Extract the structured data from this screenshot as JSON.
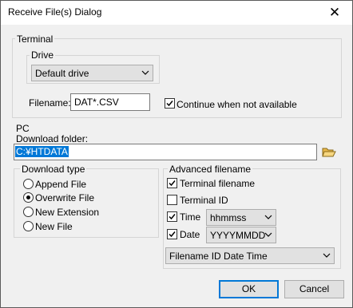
{
  "window": {
    "title": "Receive File(s) Dialog",
    "close_glyph": "✕"
  },
  "terminal": {
    "group_label": "Terminal",
    "drive": {
      "group_label": "Drive",
      "selected": "Default drive"
    },
    "filename": {
      "label": "Filename:",
      "value": "DAT*.CSV"
    },
    "continue": {
      "label": "Continue when not available",
      "checked": true
    }
  },
  "pc": {
    "group_label": "PC",
    "download_folder": {
      "label": "Download folder:",
      "value": "C:¥HTDATA"
    }
  },
  "download_type": {
    "group_label": "Download type",
    "options": [
      {
        "label": "Append File",
        "selected": false
      },
      {
        "label": "Overwrite File",
        "selected": true
      },
      {
        "label": "New Extension",
        "selected": false
      },
      {
        "label": "New File",
        "selected": false
      }
    ]
  },
  "advanced": {
    "group_label": "Advanced filename",
    "terminal_filename": {
      "label": "Terminal filename",
      "checked": true
    },
    "terminal_id": {
      "label": "Terminal ID",
      "checked": false
    },
    "time": {
      "label": "Time",
      "checked": true,
      "format": "hhmmss"
    },
    "date": {
      "label": "Date",
      "checked": true,
      "format": "YYYYMMDD"
    },
    "order": "Filename ID Date Time"
  },
  "buttons": {
    "ok": "OK",
    "cancel": "Cancel"
  },
  "icons": {
    "folder": "folder-open-icon",
    "chevron": "chevron-down-icon"
  },
  "colors": {
    "selection": "#0078d7",
    "folder": "#e8b84a"
  }
}
